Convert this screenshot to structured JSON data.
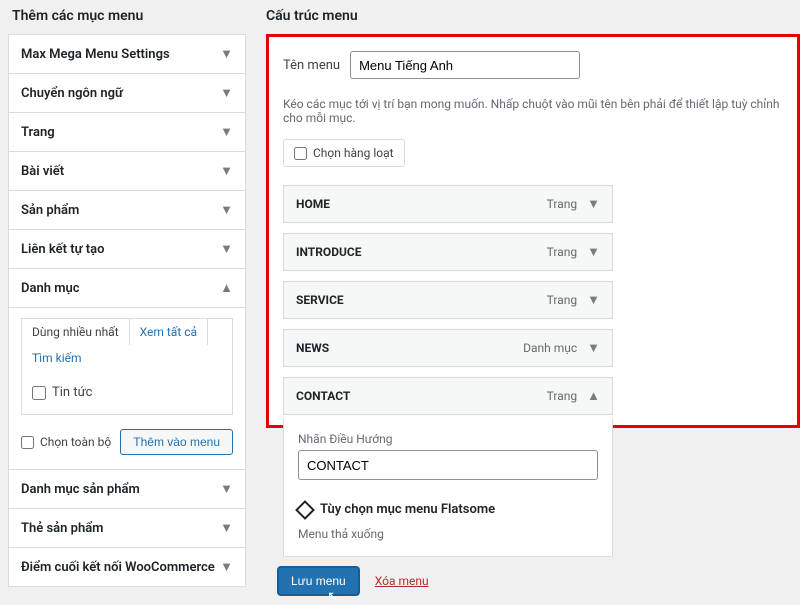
{
  "left": {
    "title": "Thêm các mục menu",
    "items": [
      {
        "label": "Max Mega Menu Settings"
      },
      {
        "label": "Chuyển ngôn ngữ"
      },
      {
        "label": "Trang"
      },
      {
        "label": "Bài viết"
      },
      {
        "label": "Sản phẩm"
      },
      {
        "label": "Liên kết tự tạo"
      }
    ],
    "danh_muc": {
      "label": "Danh mục",
      "tabs": {
        "most_used": "Dùng nhiều nhất",
        "view_all": "Xem tất cả",
        "search": "Tìm kiếm"
      },
      "checklist": [
        {
          "label": "Tin tức"
        }
      ],
      "select_all": "Chọn toàn bộ",
      "add_button": "Thêm vào menu"
    },
    "tail_items": [
      {
        "label": "Danh mục sản phẩm"
      },
      {
        "label": "Thẻ sản phẩm"
      },
      {
        "label": "Điểm cuối kết nối WooCommerce"
      }
    ]
  },
  "right": {
    "title": "Cấu trúc menu",
    "menu_name_label": "Tên menu",
    "menu_name_value": "Menu Tiếng Anh",
    "drag_hint": "Kéo các mục tới vị trí bạn mong muốn. Nhấp chuột vào mũi tên bên phải để thiết lập tuỳ chỉnh cho mỗi mục.",
    "bulk_select": "Chọn hàng loạt",
    "menu_items": [
      {
        "title": "HOME",
        "type": "Trang",
        "expanded": false
      },
      {
        "title": "INTRODUCE",
        "type": "Trang",
        "expanded": false
      },
      {
        "title": "SERVICE",
        "type": "Trang",
        "expanded": false
      },
      {
        "title": "NEWS",
        "type": "Danh mục",
        "expanded": false
      },
      {
        "title": "CONTACT",
        "type": "Trang",
        "expanded": true
      }
    ],
    "expanded": {
      "nav_label_title": "Nhãn Điều Hướng",
      "nav_label_value": "CONTACT",
      "option_section": "Tùy chọn mục menu Flatsome",
      "dropdown_label": "Menu thả xuống"
    },
    "save_button": "Lưu menu",
    "delete_link": "Xóa menu"
  }
}
